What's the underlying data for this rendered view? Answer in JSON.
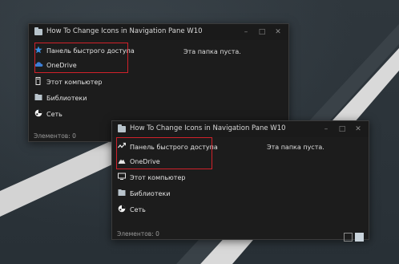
{
  "window1": {
    "title": "How To Change Icons in Navigation Pane W10",
    "controls": {
      "minimize": "–",
      "maximize": "□",
      "close": "✕"
    },
    "nav_items": [
      {
        "label": "Панель быстрого доступа",
        "icon": "quick-access-star-icon"
      },
      {
        "label": "OneDrive",
        "icon": "onedrive-cloud-icon"
      },
      {
        "label": "Этот компьютер",
        "icon": "this-pc-icon"
      },
      {
        "label": "Библиотеки",
        "icon": "libraries-icon"
      },
      {
        "label": "Сеть",
        "icon": "network-icon"
      }
    ],
    "empty_message": "Эта папка пуста.",
    "status": "Элементов: 0"
  },
  "window2": {
    "title": "How To Change Icons in Navigation Pane W10",
    "controls": {
      "minimize": "–",
      "maximize": "□",
      "close": "✕"
    },
    "nav_items": [
      {
        "label": "Панель быстрого доступа",
        "icon": "quick-access-pulse-icon"
      },
      {
        "label": "OneDrive",
        "icon": "onedrive-mountain-icon"
      },
      {
        "label": "Этот компьютер",
        "icon": "this-pc-icon"
      },
      {
        "label": "Библиотеки",
        "icon": "libraries-icon"
      },
      {
        "label": "Сеть",
        "icon": "network-icon"
      }
    ],
    "empty_message": "Эта папка пуста.",
    "status": "Элементов: 0"
  },
  "colors": {
    "highlight": "#d0212a",
    "star_blue": "#3b8fe0",
    "window_bg": "#1c1c1c"
  }
}
